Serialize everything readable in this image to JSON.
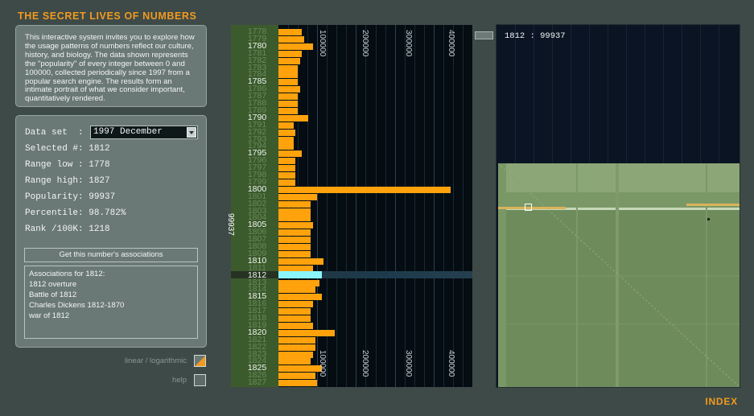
{
  "app": {
    "title": "THE SECRET LIVES OF NUMBERS",
    "index_link": "INDEX"
  },
  "intro": {
    "text": "This interactive system invites you to explore how the usage patterns of numbers reflect our culture, history, and biology. The data shown represents the \"popularity\" of every integer between 0 and 100000, collected periodically since 1997 from a popular search engine. The results form an intimate portrait of what we consider important, quantitatively rendered."
  },
  "info": {
    "dataset_label": "Data set  :",
    "dataset_value": "1997 December",
    "selected_label": "Selected #:",
    "selected_value": "1812",
    "range_low_label": "Range low :",
    "range_low_value": "1778",
    "range_high_label": "Range high:",
    "range_high_value": "1827",
    "popularity_label": "Popularity:",
    "popularity_value": "99937",
    "percentile_label": "Percentile:",
    "percentile_value": "98.782%",
    "rank_label": "Rank /100K:",
    "rank_value": "1218"
  },
  "associations": {
    "button_label": "Get this number's associations",
    "header": "Associations for 1812:",
    "items": [
      "1812 overture",
      "Battle of 1812",
      "Charles Dickens 1812-1870",
      "war of 1812"
    ]
  },
  "toggles": {
    "scale_label": "linear / logarithmic",
    "help_label": "help"
  },
  "colors": {
    "accent": "#f29a1e",
    "bar": "#ffa20c",
    "selected_bar": "#8af6fb",
    "year_column": "#3b5b2d",
    "map_field": "#6f8c5c"
  },
  "chart_data": {
    "type": "bar",
    "orientation": "horizontal",
    "y_categories": [
      1778,
      1779,
      1780,
      1781,
      1782,
      1783,
      1784,
      1785,
      1786,
      1787,
      1788,
      1789,
      1790,
      1791,
      1792,
      1793,
      1794,
      1795,
      1796,
      1797,
      1798,
      1799,
      1800,
      1801,
      1802,
      1803,
      1804,
      1805,
      1806,
      1807,
      1808,
      1809,
      1810,
      1811,
      1812,
      1813,
      1814,
      1815,
      1816,
      1817,
      1818,
      1819,
      1820,
      1821,
      1822,
      1823,
      1824,
      1825,
      1826,
      1827
    ],
    "labeled_years": [
      "1780",
      "1785",
      "1790",
      "1795",
      "1800",
      "1805",
      "1810",
      "1812",
      "1815",
      "1820",
      "1825"
    ],
    "values": [
      55000,
      60000,
      80000,
      55000,
      50000,
      45000,
      45000,
      45000,
      50000,
      45000,
      45000,
      45000,
      70000,
      35000,
      40000,
      35000,
      35000,
      55000,
      40000,
      40000,
      40000,
      40000,
      400000,
      90000,
      75000,
      75000,
      75000,
      80000,
      75000,
      75000,
      75000,
      75000,
      105000,
      80000,
      99937,
      95000,
      85000,
      100000,
      80000,
      75000,
      75000,
      80000,
      130000,
      85000,
      85000,
      80000,
      75000,
      100000,
      85000,
      90000
    ],
    "selected": {
      "year": "1812",
      "value": "99937"
    },
    "x_ticks": [
      "100000",
      "200000",
      "300000",
      "400000"
    ],
    "xlim": [
      0,
      450000
    ]
  },
  "map": {
    "readout": "1812 : 99937"
  }
}
